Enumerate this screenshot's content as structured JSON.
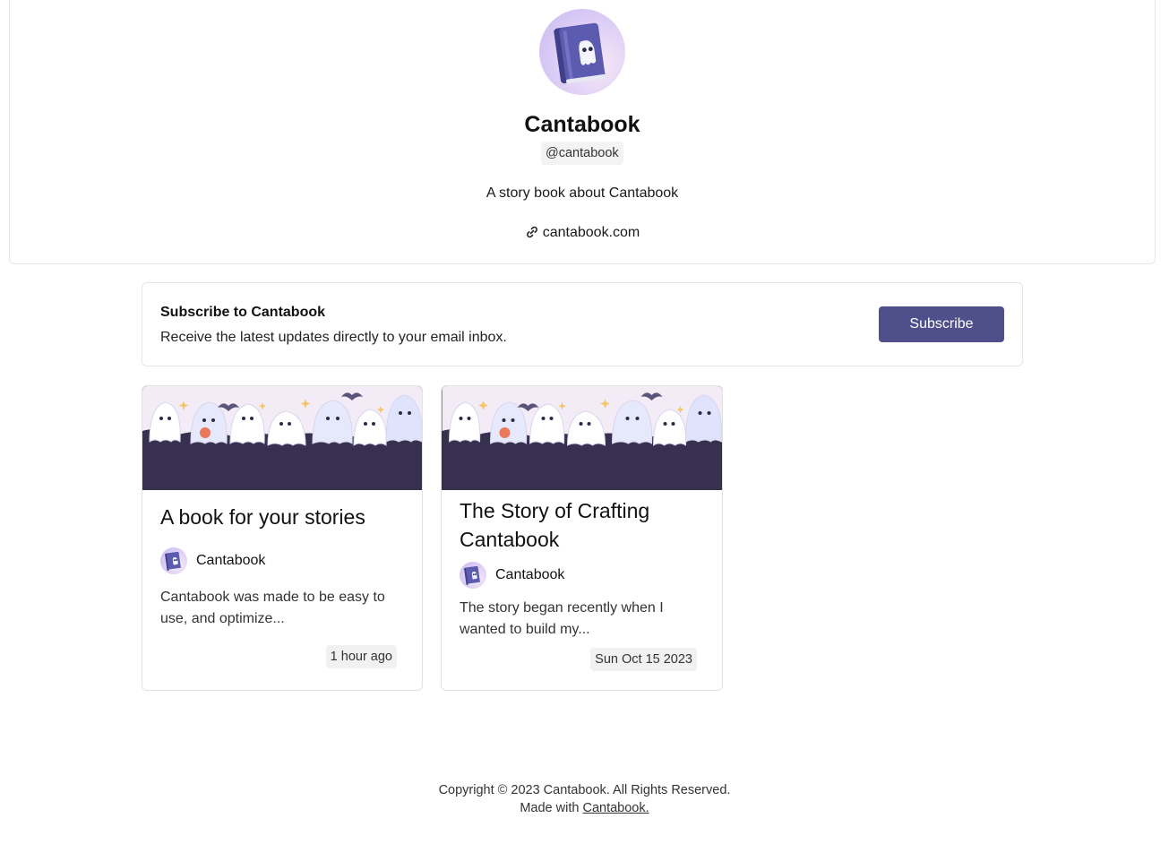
{
  "profile": {
    "name": "Cantabook",
    "handle": "@cantabook",
    "bio": "A story book about Cantabook",
    "website": "cantabook.com"
  },
  "subscribe": {
    "title": "Subscribe to Cantabook",
    "description": "Receive the latest updates directly to your email inbox.",
    "button_label": "Subscribe"
  },
  "posts": [
    {
      "title": "A book for your stories",
      "author": "Cantabook",
      "excerpt": "Cantabook was made to be easy to use, and optimize...",
      "date": "1 hour ago"
    },
    {
      "title": "The Story of Crafting Cantabook",
      "author": "Cantabook",
      "excerpt": "The story began recently when I wanted to build my...",
      "date": "Sun Oct 15 2023"
    }
  ],
  "footer": {
    "copyright": "Copyright © 2023 Cantabook. All Rights Reserved.",
    "made_with_prefix": "Made with",
    "made_with_link": "Cantabook."
  },
  "colors": {
    "accent": "#4f4f8c",
    "cover_background": "#37304f",
    "border": "#e5e5e5"
  },
  "icons": [
    "book-ghost-logo-icon",
    "link-icon"
  ]
}
